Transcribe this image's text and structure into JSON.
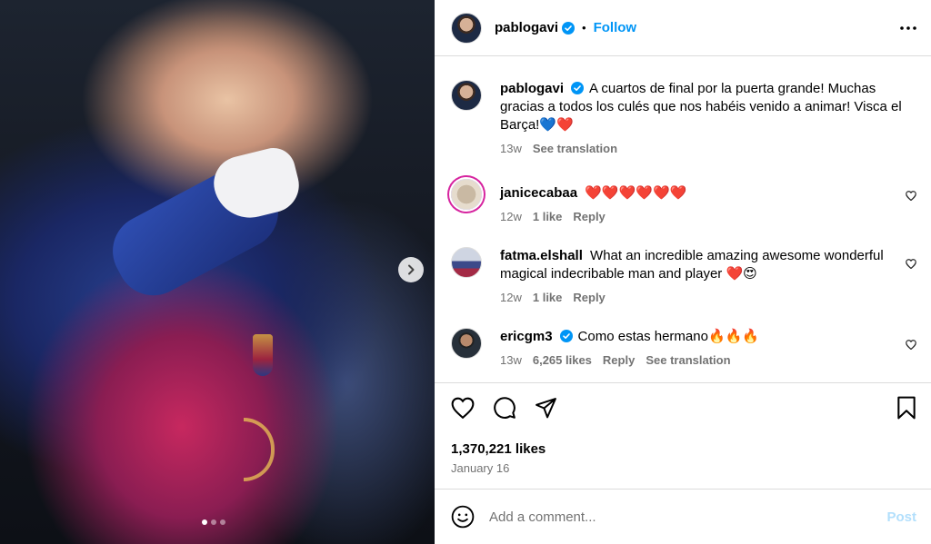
{
  "colors": {
    "accent": "#0095f6",
    "muted": "#737373",
    "border": "#dbdbdb",
    "post_disabled": "#b2dffc"
  },
  "header": {
    "username": "pablogavi",
    "bullet": "•",
    "follow_label": "Follow",
    "more_icon": "more-horizontal-icon"
  },
  "caption": {
    "username": "pablogavi",
    "text": "A cuartos de final por la puerta grande! Muchas gracias a todos los culés que nos habéis venido a animar! Visca el Barça!💙❤️",
    "time": "13w",
    "see_translation": "See translation"
  },
  "comments": [
    {
      "username": "janicecabaa",
      "text": "❤️❤️❤️❤️❤️❤️",
      "time": "12w",
      "likes": "1 like",
      "reply": "Reply"
    },
    {
      "username": "fatma.elshall",
      "text": "What an incredible amazing awesome wonderful magical indecribable man and player ❤️😍",
      "time": "12w",
      "likes": "1 like",
      "reply": "Reply"
    },
    {
      "username": "ericgm3",
      "text": "Como estas hermano🔥🔥🔥",
      "time": "13w",
      "likes": "6,265 likes",
      "reply": "Reply",
      "see_translation": "See translation"
    }
  ],
  "stats": {
    "likes": "1,370,221 likes",
    "date": "January 16"
  },
  "composer": {
    "placeholder": "Add a comment...",
    "post_label": "Post"
  },
  "carousel": {
    "slide_count": 3,
    "active_index": 0
  }
}
